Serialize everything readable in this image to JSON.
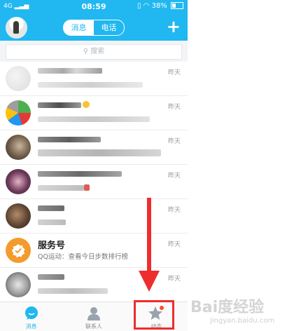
{
  "status_bar": {
    "network": "4G",
    "time": "08:59",
    "battery": "38%"
  },
  "header": {
    "tabs": [
      {
        "label": "消息",
        "active": true
      },
      {
        "label": "电话",
        "active": false
      }
    ],
    "add_icon": "plus-icon"
  },
  "search": {
    "placeholder": "搜索"
  },
  "conversations": [
    {
      "time": "昨天"
    },
    {
      "time": "昨天"
    },
    {
      "time": "昨天"
    },
    {
      "time": "昨天"
    },
    {
      "time": "昨天"
    },
    {
      "title": "服务号",
      "preview": "QQ运动：查看今日步数排行榜",
      "time": "昨天"
    },
    {
      "time": "昨天"
    }
  ],
  "tabbar": {
    "items": [
      {
        "label": "消息",
        "icon": "chat-bubble-icon",
        "active": true
      },
      {
        "label": "联系人",
        "icon": "contacts-icon",
        "active": false
      },
      {
        "label": "动态",
        "icon": "star-icon",
        "active": false,
        "badge": true
      }
    ]
  },
  "colors": {
    "brand_blue": "#21b7f0",
    "annotation_red": "#ee2d2d",
    "service_orange": "#f39b2c"
  },
  "watermark": {
    "brand": "Bai度经验",
    "url": "jingyan.baidu.com"
  }
}
